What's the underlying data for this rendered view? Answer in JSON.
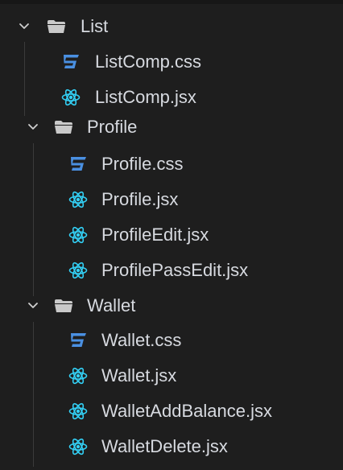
{
  "tree": {
    "list": {
      "name": "List",
      "files": [
        {
          "name": "ListComp.css",
          "type": "css"
        },
        {
          "name": "ListComp.jsx",
          "type": "jsx"
        }
      ]
    },
    "profile": {
      "name": "Profile",
      "files": [
        {
          "name": "Profile.css",
          "type": "css"
        },
        {
          "name": "Profile.jsx",
          "type": "jsx"
        },
        {
          "name": "ProfileEdit.jsx",
          "type": "jsx"
        },
        {
          "name": "ProfilePassEdit.jsx",
          "type": "jsx"
        }
      ]
    },
    "wallet": {
      "name": "Wallet",
      "files": [
        {
          "name": "Wallet.css",
          "type": "css"
        },
        {
          "name": "Wallet.jsx",
          "type": "jsx"
        },
        {
          "name": "WalletAddBalance.jsx",
          "type": "jsx"
        },
        {
          "name": "WalletDelete.jsx",
          "type": "jsx"
        }
      ]
    }
  },
  "icons": {
    "folder": "folder-open-icon",
    "chevron": "chevron-down-icon",
    "css": "css3-icon",
    "jsx": "react-icon"
  },
  "colors": {
    "background": "#1e1e1e",
    "text": "#d7dae0",
    "css_icon": "#4a90e2",
    "react_icon": "#33d0f5",
    "folder_icon": "#c9c9c9"
  }
}
